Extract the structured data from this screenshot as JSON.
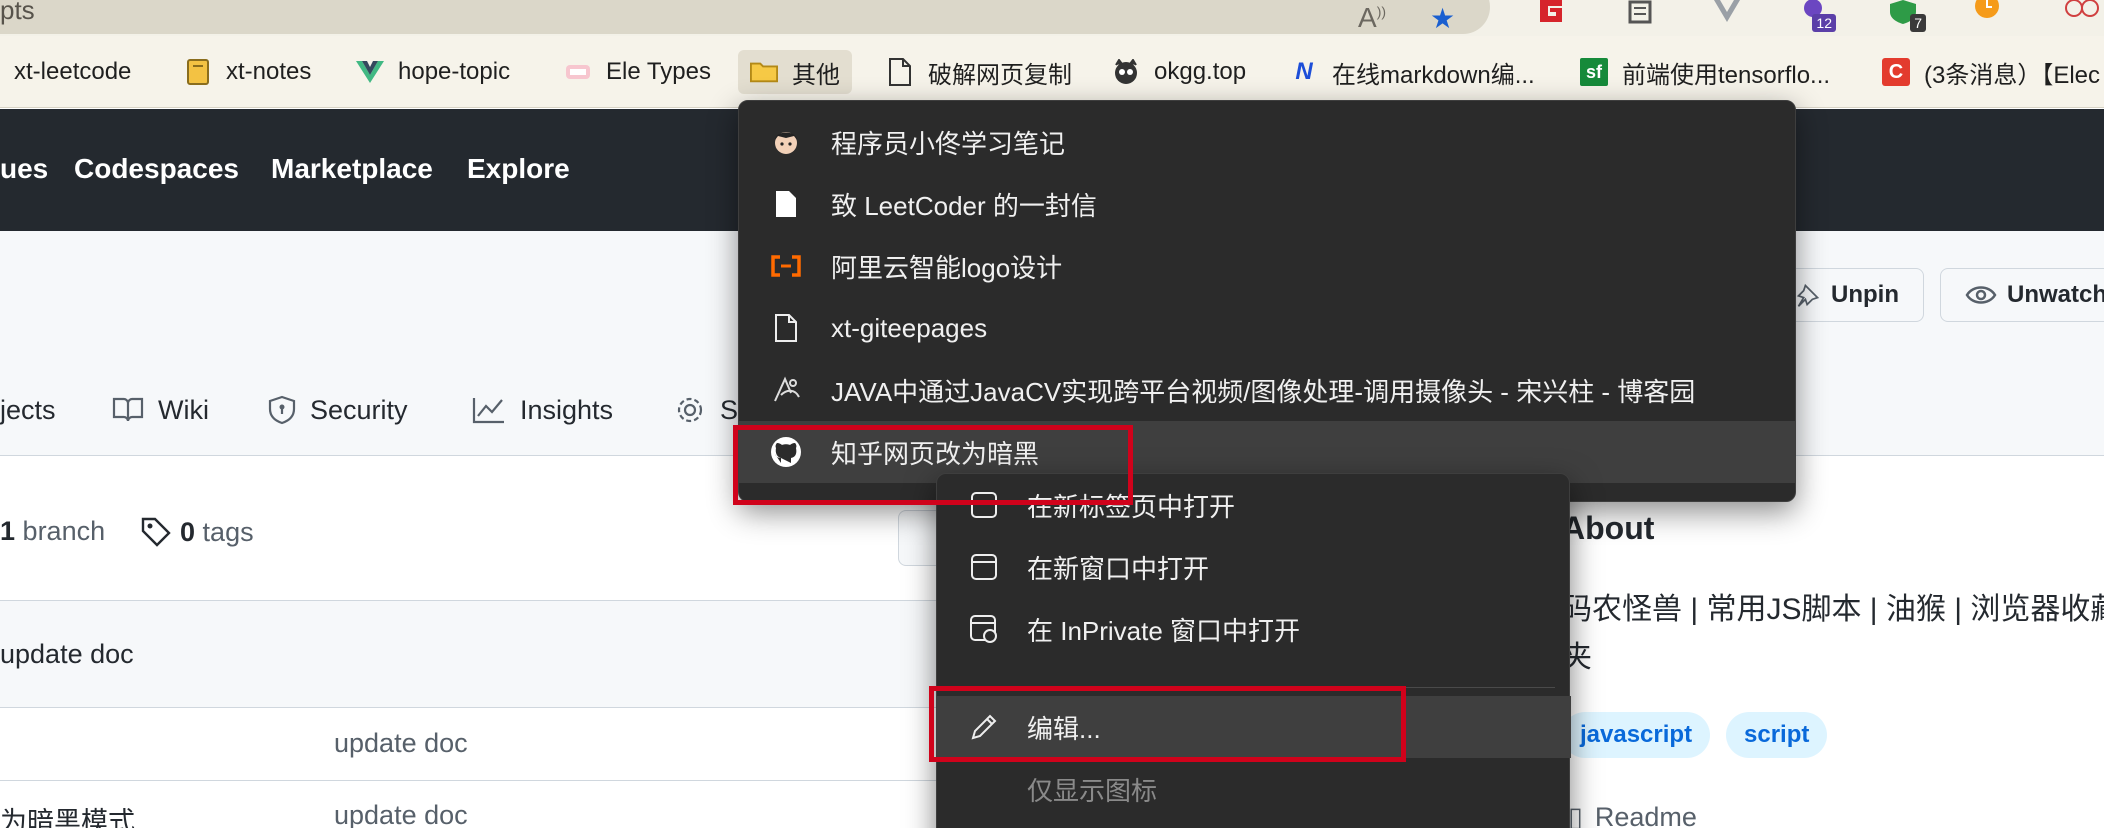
{
  "browser": {
    "address_text": "pts",
    "extension_badges": [
      "12",
      "7"
    ]
  },
  "bookmarks": [
    {
      "label": "xt-leetcode",
      "icon": "vue-icon"
    },
    {
      "label": "xt-notes",
      "icon": "notebook-icon"
    },
    {
      "label": "hope-topic",
      "icon": "vue-icon"
    },
    {
      "label": "Ele Types",
      "icon": "ele-icon"
    },
    {
      "label": "其他",
      "icon": "folder-icon"
    },
    {
      "label": "破解网页复制",
      "icon": "page-icon"
    },
    {
      "label": "okgg.top",
      "icon": "cat-icon"
    },
    {
      "label": "在线markdown编...",
      "icon": "n-logo-icon"
    },
    {
      "label": "前端使用tensorflo...",
      "icon": "sf-icon"
    },
    {
      "label": "(3条消息）【Elec",
      "icon": "csdn-icon"
    }
  ],
  "github": {
    "nav": [
      "ues",
      "Codespaces",
      "Marketplace",
      "Explore"
    ],
    "unpin_label": "Unpin",
    "unwatch_label": "Unwatch",
    "tabs": [
      "jects",
      "Wiki",
      "Security",
      "Insights",
      "S"
    ],
    "branch_count": "1",
    "branch_label": "branch",
    "tag_count": "0",
    "tag_label": "tags",
    "latest_commit": "update doc",
    "rows": [
      {
        "name": "",
        "message": "update doc"
      },
      {
        "name": "为暗黑模式",
        "message": "update doc"
      }
    ],
    "about": {
      "title": "About",
      "description": "码农怪兽 | 常用JS脚本 | 油猴 | 浏览器收藏夹",
      "topics": [
        "javascript",
        "script"
      ],
      "readme": "Readme"
    }
  },
  "folder_menu": {
    "items": [
      {
        "label": "程序员小佟学习笔记",
        "icon": "avatar-icon"
      },
      {
        "label": "致 LeetCoder 的一封信",
        "icon": "page-icon"
      },
      {
        "label": "阿里云智能logo设计",
        "icon": "aliyun-icon"
      },
      {
        "label": "xt-giteepages",
        "icon": "page-icon"
      },
      {
        "label": "JAVA中通过JavaCV实现跨平台视频/图像处理-调用摄像头 - 宋兴柱 - 博客园",
        "icon": "cnblogs-icon"
      },
      {
        "label": "知乎网页改为暗黑",
        "icon": "github-icon"
      }
    ]
  },
  "context_menu": {
    "items": [
      {
        "label": "在新标签页中打开",
        "icon": "new-tab-icon"
      },
      {
        "label": "在新窗口中打开",
        "icon": "new-window-icon"
      },
      {
        "label": "在 InPrivate 窗口中打开",
        "icon": "inprivate-icon"
      },
      {
        "label": "编辑...",
        "icon": "pencil-icon"
      },
      {
        "label": "仅显示图标",
        "icon": ""
      }
    ]
  },
  "colors": {
    "highlight": "#d0021b",
    "menu_bg": "#2b2b2b",
    "github_header": "#24292f",
    "topic_bg": "#ddf4ff",
    "topic_fg": "#0969da"
  }
}
